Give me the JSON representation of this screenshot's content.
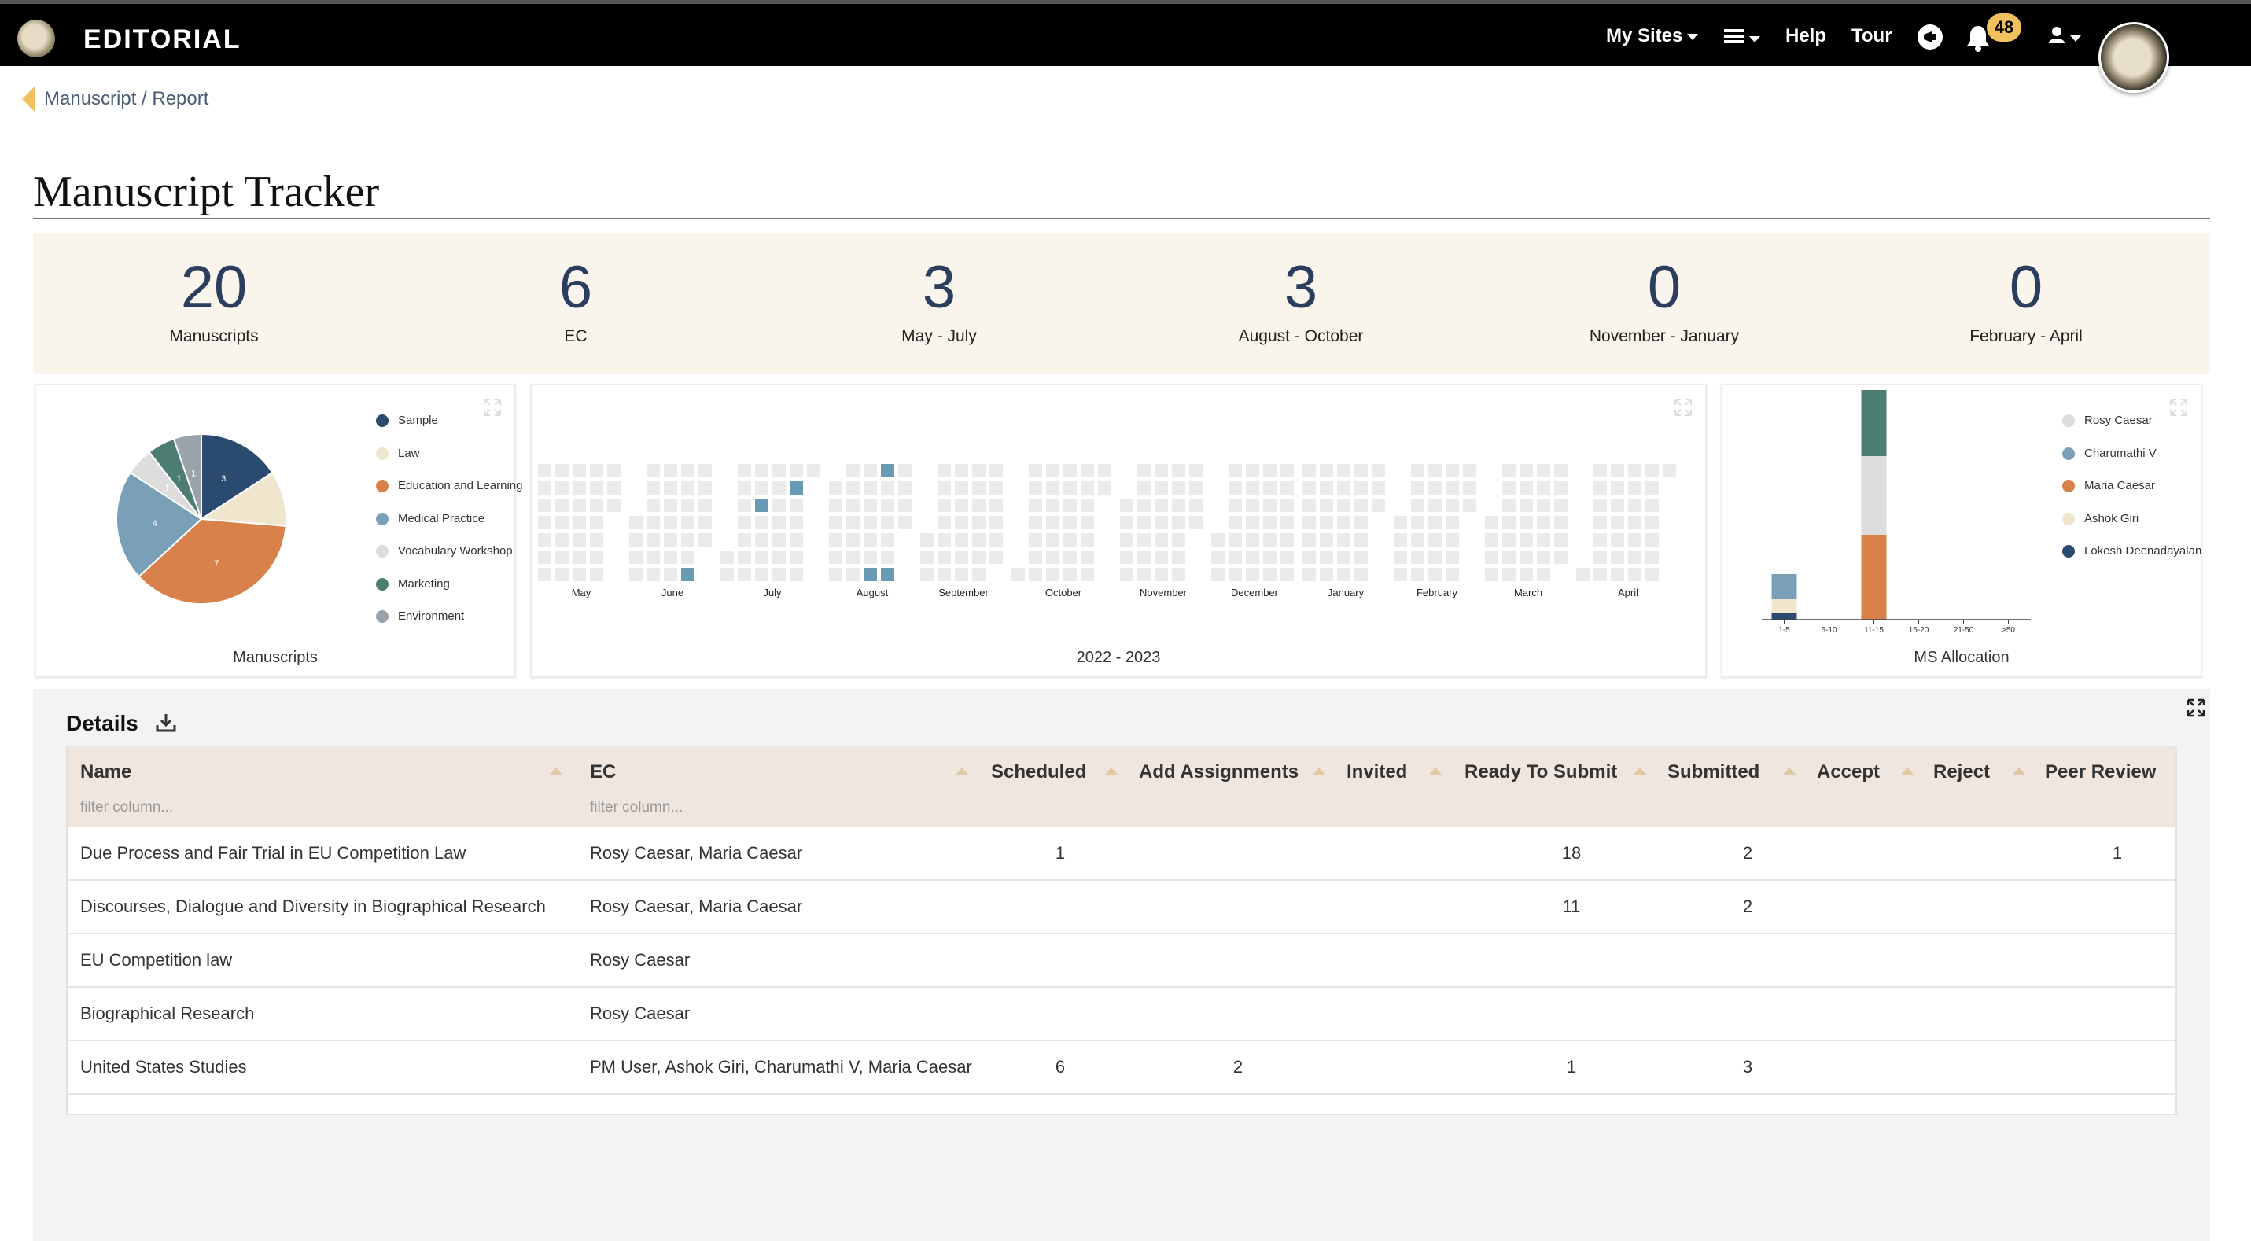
{
  "app": {
    "brand": "EDITORIAL"
  },
  "nav": {
    "my_sites": "My Sites",
    "help": "Help",
    "tour": "Tour",
    "notifications_count": "48"
  },
  "breadcrumb": {
    "text": "Manuscript  /  Report"
  },
  "page": {
    "title": "Manuscript Tracker"
  },
  "stats": [
    {
      "value": "20",
      "label": "Manuscripts"
    },
    {
      "value": "6",
      "label": "EC"
    },
    {
      "value": "3",
      "label": "May - July"
    },
    {
      "value": "3",
      "label": "August - October"
    },
    {
      "value": "0",
      "label": "November - January"
    },
    {
      "value": "0",
      "label": "February - April"
    }
  ],
  "pie_card": {
    "caption": "Manuscripts",
    "legend": [
      "Sample",
      "Law",
      "Education and Learning",
      "Medical Practice",
      "Vocabulary Workshop",
      "Marketing",
      "Environment"
    ],
    "colors": [
      "#2b4a6f",
      "#efe6cd",
      "#d9814a",
      "#7aa0b8",
      "#dddddd",
      "#4d7c72",
      "#9aa3aa"
    ]
  },
  "heat_card": {
    "caption": "2022 - 2023",
    "months": [
      "May",
      "June",
      "July",
      "August",
      "September",
      "October",
      "November",
      "December",
      "January",
      "February",
      "March",
      "April"
    ]
  },
  "bar_card": {
    "caption": "MS Allocation",
    "legend": [
      "Rosy Caesar",
      "Charumathi V",
      "Maria Caesar",
      "Ashok Giri",
      "Lokesh Deenadayalan"
    ],
    "colors": [
      "#dddddd",
      "#7aa0b8",
      "#d9814a",
      "#efe6cd",
      "#2b4a6f"
    ],
    "x_labels": [
      "1-5",
      "6-10",
      "11-15",
      "16-20",
      "21-50",
      ">50"
    ]
  },
  "chart_data": [
    {
      "type": "pie",
      "title": "",
      "labels": [
        "Sample",
        "Law",
        "Education and Learning",
        "Medical Practice",
        "Vocabulary Workshop",
        "Marketing",
        "Environment"
      ],
      "values": [
        3,
        2,
        7,
        4,
        1,
        1,
        1
      ],
      "data_labels": [
        "3",
        "",
        "7",
        "4",
        "1",
        "1",
        "1"
      ]
    },
    {
      "type": "heatmap",
      "title": "",
      "xlabel": "2022 - 2023",
      "categories": [
        "May",
        "June",
        "July",
        "August",
        "September",
        "October",
        "November",
        "December",
        "January",
        "February",
        "March",
        "April"
      ],
      "highlighted_counts": [
        0,
        1,
        2,
        3,
        0,
        0,
        0,
        0,
        0,
        0,
        0,
        0
      ]
    },
    {
      "type": "bar",
      "stacked": true,
      "title": "",
      "xlabel": "MS Allocation",
      "categories": [
        "1-5",
        "6-10",
        "11-15",
        "16-20",
        "21-50",
        ">50"
      ],
      "series": [
        {
          "name": "Lokesh Deenadayalan",
          "values": [
            1,
            0,
            0,
            0,
            0,
            0
          ]
        },
        {
          "name": "Ashok Giri",
          "values": [
            0,
            0,
            0,
            0,
            0,
            0
          ]
        },
        {
          "name": "Maria Caesar",
          "values": [
            0,
            0,
            1,
            0,
            0,
            0
          ]
        },
        {
          "name": "Charumathi V",
          "values": [
            1,
            0,
            0,
            0,
            0,
            0
          ]
        },
        {
          "name": "Rosy Caesar",
          "values": [
            0,
            0,
            1,
            0,
            0,
            0
          ]
        },
        {
          "name": "",
          "values": [
            0,
            0,
            1,
            0,
            0,
            0
          ]
        }
      ]
    }
  ],
  "details": {
    "title": "Details",
    "filter_placeholder": "filter column...",
    "columns": [
      "Name",
      "EC",
      "Scheduled",
      "Add Assignments",
      "Invited",
      "Ready To Submit",
      "Submitted",
      "Accept",
      "Reject",
      "Peer Review"
    ],
    "rows": [
      {
        "name": "Due Process and Fair Trial in EU Competition Law",
        "ec": "Rosy Caesar, Maria Caesar",
        "scheduled": "1",
        "add_assignments": "",
        "invited": "",
        "ready": "18",
        "submitted": "2",
        "accept": "",
        "reject": "",
        "peer": "1"
      },
      {
        "name": "Discourses, Dialogue and Diversity in Biographical Research",
        "ec": "Rosy Caesar, Maria Caesar",
        "scheduled": "",
        "add_assignments": "",
        "invited": "",
        "ready": "11",
        "submitted": "2",
        "accept": "",
        "reject": "",
        "peer": ""
      },
      {
        "name": "EU Competition law",
        "ec": "Rosy Caesar",
        "scheduled": "",
        "add_assignments": "",
        "invited": "",
        "ready": "",
        "submitted": "",
        "accept": "",
        "reject": "",
        "peer": ""
      },
      {
        "name": "Biographical Research",
        "ec": "Rosy Caesar",
        "scheduled": "",
        "add_assignments": "",
        "invited": "",
        "ready": "",
        "submitted": "",
        "accept": "",
        "reject": "",
        "peer": ""
      },
      {
        "name": "United States Studies",
        "ec": "PM User, Ashok Giri, Charumathi V, Maria Caesar",
        "scheduled": "6",
        "add_assignments": "2",
        "invited": "",
        "ready": "1",
        "submitted": "3",
        "accept": "",
        "reject": "",
        "peer": ""
      }
    ]
  }
}
